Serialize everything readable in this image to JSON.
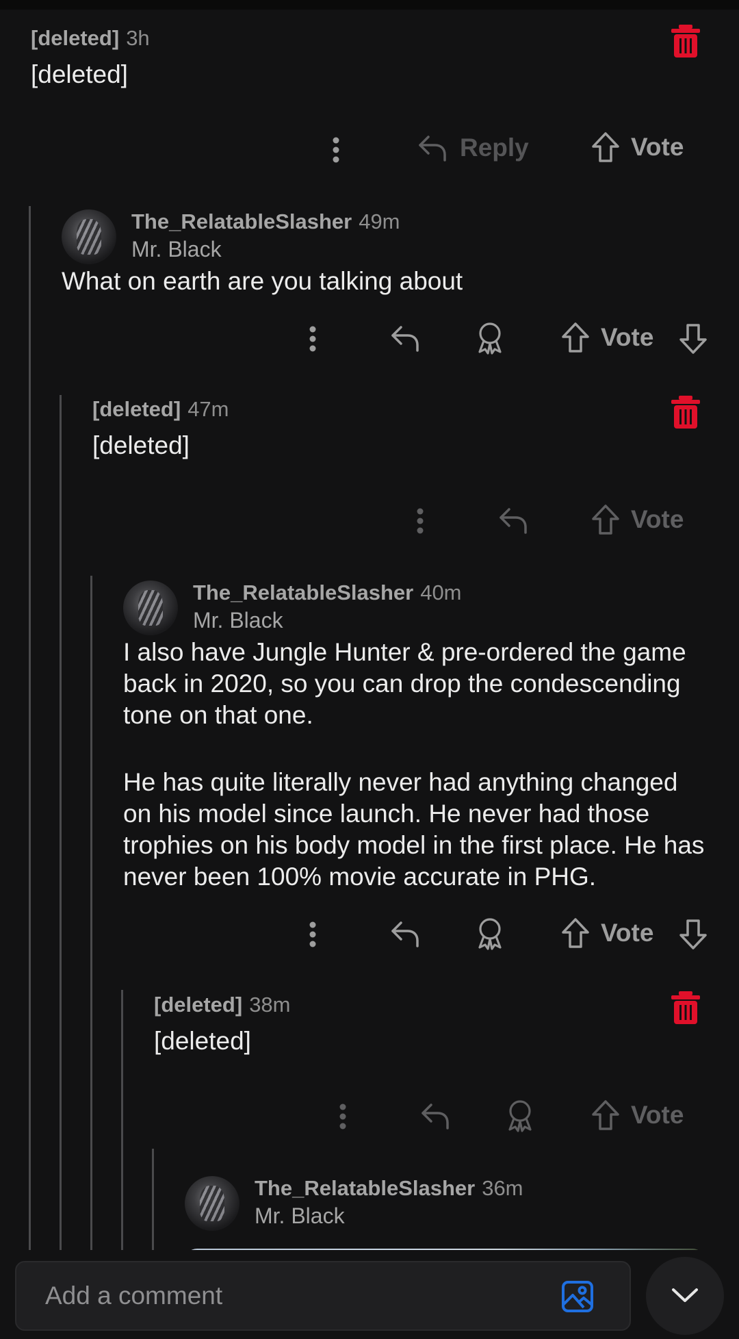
{
  "comments": [
    {
      "author": "[deleted]",
      "time": "3h",
      "flair": "",
      "body": [
        "[deleted]"
      ]
    },
    {
      "author": "The_RelatableSlasher",
      "time": "49m",
      "flair": "Mr. Black",
      "body": [
        "What on earth are you talking about"
      ]
    },
    {
      "author": "[deleted]",
      "time": "47m",
      "flair": "",
      "body": [
        "[deleted]"
      ]
    },
    {
      "author": "The_RelatableSlasher",
      "time": "40m",
      "flair": "Mr. Black",
      "body": [
        "I also have Jungle Hunter & pre-ordered the game back in 2020, so you can drop the condescending tone on that one.",
        "He has quite literally never had anything changed on his model since launch. He never had those trophies on his body model in the first place. He has never been 100% movie accurate in PHG."
      ]
    },
    {
      "author": "[deleted]",
      "time": "38m",
      "flair": "",
      "body": [
        "[deleted]"
      ]
    },
    {
      "author": "The_RelatableSlasher",
      "time": "36m",
      "flair": "Mr. Black",
      "body": []
    }
  ],
  "actions": {
    "reply_label": "Reply",
    "vote_label": "Vote"
  },
  "composer": {
    "placeholder": "Add a comment"
  },
  "icons": {
    "trash": "trash-icon",
    "more": "more-vertical-icon",
    "reply": "reply-arrow-icon",
    "award": "award-icon",
    "upvote": "upvote-arrow-icon",
    "downvote": "downvote-arrow-icon",
    "image": "image-upload-icon",
    "collapse": "chevron-down-icon"
  },
  "colors": {
    "background": "#121213",
    "delete_red": "#e0102a",
    "image_blue": "#1f6fe0",
    "thread_line": "#4a4a4c"
  }
}
